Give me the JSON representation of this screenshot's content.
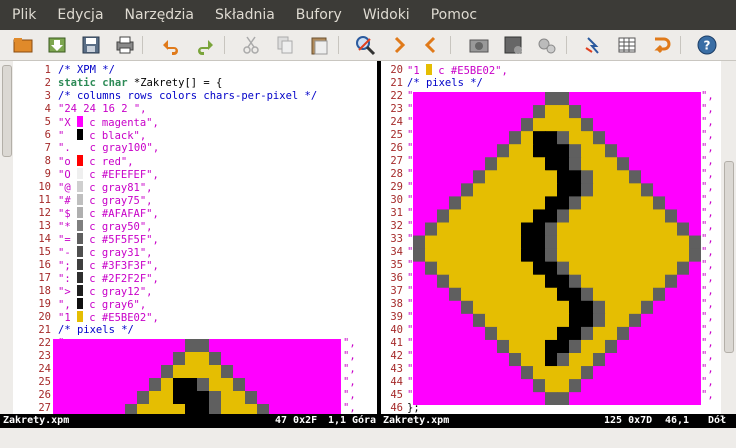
{
  "menu": [
    "Plik",
    "Edycja",
    "Narzędzia",
    "Składnia",
    "Bufory",
    "Widoki",
    "Pomoc"
  ],
  "toolbar": [
    "open-icon",
    "save-download-icon",
    "save-icon",
    "print-icon",
    "undo-icon",
    "redo-icon",
    "cut-icon",
    "copy-icon",
    "paste-icon",
    "find-icon",
    "find-next-icon",
    "find-prev-icon",
    "load-session-icon",
    "save-session-icon",
    "run-script-icon",
    "make-icon",
    "tags-icon",
    "jump-icon",
    "help-icon"
  ],
  "left_lines": [
    {
      "n": "1",
      "parts": [
        [
          "cmt",
          "/* XPM */"
        ]
      ]
    },
    {
      "n": "2",
      "parts": [
        [
          "kw",
          "static char"
        ],
        [
          "plain",
          " *Zakrety[] = {"
        ]
      ]
    },
    {
      "n": "3",
      "parts": [
        [
          "cmt",
          "/* columns rows colors chars-per-pixel */"
        ]
      ]
    },
    {
      "n": "4",
      "parts": [
        [
          "str",
          "\"24 24 16 2 \","
        ]
      ]
    },
    {
      "n": "5",
      "parts": [
        [
          "str",
          "\"X "
        ],
        [
          "sw",
          "#ff00ff"
        ],
        [
          "str",
          " c magenta\","
        ]
      ]
    },
    {
      "n": "6",
      "parts": [
        [
          "str",
          "\"  "
        ],
        [
          "sw",
          "#000000"
        ],
        [
          "str",
          " c black\","
        ]
      ]
    },
    {
      "n": "7",
      "parts": [
        [
          "str",
          "\".  "
        ],
        [
          "str",
          " c gray100\","
        ]
      ]
    },
    {
      "n": "8",
      "parts": [
        [
          "str",
          "\"o "
        ],
        [
          "sw",
          "#ff0000"
        ],
        [
          "str",
          " c red\","
        ]
      ]
    },
    {
      "n": "9",
      "parts": [
        [
          "str",
          "\"O "
        ],
        [
          "sw",
          "#efefef"
        ],
        [
          "str",
          " c #EFEFEF\","
        ]
      ]
    },
    {
      "n": "10",
      "parts": [
        [
          "str",
          "\"@ "
        ],
        [
          "sw",
          "#cfcfcf"
        ],
        [
          "str",
          " c gray81\","
        ]
      ]
    },
    {
      "n": "11",
      "parts": [
        [
          "str",
          "\"# "
        ],
        [
          "sw",
          "#bfbfbf"
        ],
        [
          "str",
          " c gray75\","
        ]
      ]
    },
    {
      "n": "12",
      "parts": [
        [
          "str",
          "\"$ "
        ],
        [
          "sw",
          "#afafaf"
        ],
        [
          "str",
          " c #AFAFAF\","
        ]
      ]
    },
    {
      "n": "13",
      "parts": [
        [
          "str",
          "\"* "
        ],
        [
          "sw",
          "#7f7f7f"
        ],
        [
          "str",
          " c gray50\","
        ]
      ]
    },
    {
      "n": "14",
      "parts": [
        [
          "str",
          "\"= "
        ],
        [
          "sw",
          "#5f5f5f"
        ],
        [
          "str",
          " c #5F5F5F\","
        ]
      ]
    },
    {
      "n": "15",
      "parts": [
        [
          "str",
          "\"- "
        ],
        [
          "sw",
          "#4f4f4f"
        ],
        [
          "str",
          " c gray31\","
        ]
      ]
    },
    {
      "n": "16",
      "parts": [
        [
          "str",
          "\"; "
        ],
        [
          "sw",
          "#3f3f3f"
        ],
        [
          "str",
          " c #3F3F3F\","
        ]
      ]
    },
    {
      "n": "17",
      "parts": [
        [
          "str",
          "\": "
        ],
        [
          "sw",
          "#2f2f2f"
        ],
        [
          "str",
          " c #2F2F2F\","
        ]
      ]
    },
    {
      "n": "18",
      "parts": [
        [
          "str",
          "\"> "
        ],
        [
          "sw",
          "#1f1f1f"
        ],
        [
          "str",
          " c gray12\","
        ]
      ]
    },
    {
      "n": "19",
      "parts": [
        [
          "str",
          "\", "
        ],
        [
          "sw",
          "#0f0f0f"
        ],
        [
          "str",
          " c gray6\","
        ]
      ]
    },
    {
      "n": "20",
      "parts": [
        [
          "str",
          "\"1 "
        ],
        [
          "sw",
          "#e5be02"
        ],
        [
          "str",
          " c #E5BE02\","
        ]
      ]
    },
    {
      "n": "21",
      "parts": [
        [
          "cmt",
          "/* pixels */"
        ]
      ]
    }
  ],
  "left_pixel_line_numbers": [
    "22",
    "23",
    "24",
    "25",
    "26",
    "27"
  ],
  "right_lines": [
    {
      "n": "20",
      "parts": [
        [
          "str",
          "\"1 "
        ],
        [
          "sw",
          "#e5be02"
        ],
        [
          "str",
          " c #E5BE02\","
        ]
      ]
    },
    {
      "n": "21",
      "parts": [
        [
          "cmt",
          "/* pixels */"
        ]
      ]
    }
  ],
  "right_pixel_line_numbers": [
    "22",
    "23",
    "24",
    "25",
    "26",
    "27",
    "28",
    "29",
    "30",
    "31",
    "32",
    "33",
    "34",
    "35",
    "36",
    "37",
    "38",
    "39",
    "40",
    "41",
    "42",
    "43",
    "44",
    "45"
  ],
  "right_last_line": {
    "n": "46",
    "text": "};"
  },
  "status_left": {
    "file": "Zakrety.xpm",
    "pos": "47 0x2F",
    "cursor": "1,1",
    "where": "Góra"
  },
  "status_right": {
    "file": "Zakrety.xpm",
    "pos": "125 0x7D",
    "cursor": "46,1",
    "where": "Dół"
  },
  "colors": {
    "magenta": "#ff00ff",
    "yellow": "#e5be02",
    "black": "#000000",
    "gray": "#5f5f5f"
  }
}
